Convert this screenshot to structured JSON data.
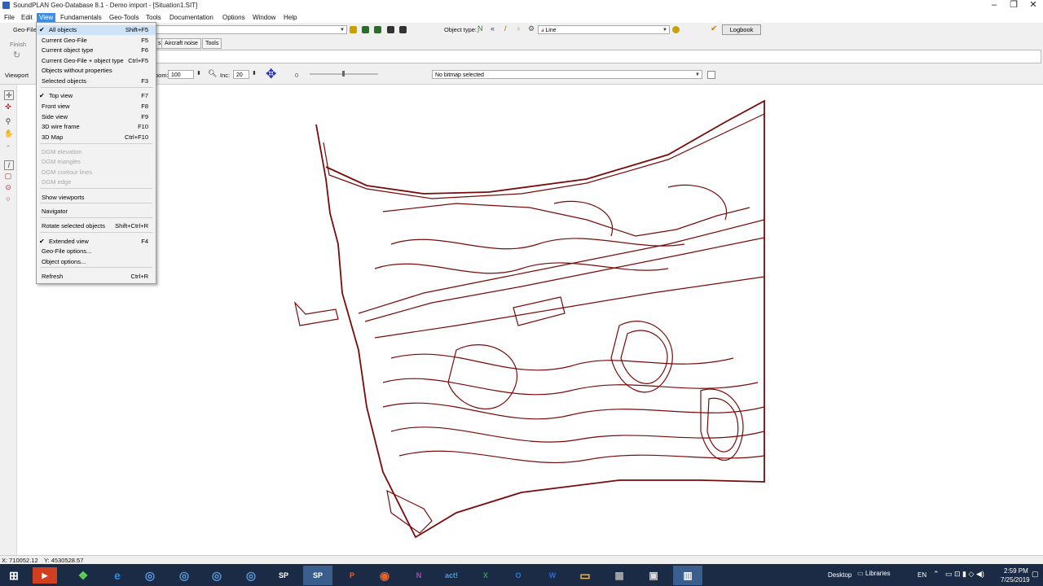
{
  "window": {
    "title": "SoundPLAN Geo-Database 8.1 - Demo import - [Situation1.SIT]"
  },
  "menus": [
    "File",
    "Edit",
    "View",
    "Fundamentals",
    "Geo-Tools",
    "Tools",
    "Documentation",
    "Options",
    "Window",
    "Help"
  ],
  "toolbar": {
    "geofile_label": "Geo-File",
    "object_type_label": "Object type:",
    "object_type_value": "Line",
    "logbook_label": "Logbook",
    "finish_label": "Finish",
    "tabs": [
      "s",
      "Aircraft noise",
      "Tools"
    ]
  },
  "viewport": {
    "label": "Viewport",
    "zoom_label": "oom:",
    "zoom_value": "100",
    "inc_label": "Inc:",
    "inc_value": "20",
    "rotation_value": "0",
    "bitmap_value": "No bitmap selected"
  },
  "view_menu": [
    {
      "label": "All objects",
      "shortcut": "Shift+F5",
      "checked": true,
      "disabled": false
    },
    {
      "label": "Current Geo-File",
      "shortcut": "F5",
      "checked": false,
      "disabled": false
    },
    {
      "label": "Current object type",
      "shortcut": "F6",
      "checked": false,
      "disabled": false
    },
    {
      "label": "Current Geo-File + object type",
      "shortcut": "Ctrl+F5",
      "checked": false,
      "disabled": false
    },
    {
      "label": "Objects without properties",
      "shortcut": "",
      "checked": false,
      "disabled": false
    },
    {
      "label": "Selected objects",
      "shortcut": "F3",
      "checked": false,
      "disabled": false
    },
    {
      "label": "Top view",
      "shortcut": "F7",
      "checked": true,
      "disabled": false
    },
    {
      "label": "Front  view",
      "shortcut": "F8",
      "checked": false,
      "disabled": false
    },
    {
      "label": "Side view",
      "shortcut": "F9",
      "checked": false,
      "disabled": false
    },
    {
      "label": "3D wire frame",
      "shortcut": "F10",
      "checked": false,
      "disabled": false
    },
    {
      "label": "3D Map",
      "shortcut": "Ctrl+F10",
      "checked": false,
      "disabled": false
    },
    {
      "label": "DGM elevation",
      "shortcut": "",
      "checked": false,
      "disabled": true
    },
    {
      "label": "DGM triangles",
      "shortcut": "",
      "checked": false,
      "disabled": true
    },
    {
      "label": "DGM contour lines",
      "shortcut": "",
      "checked": false,
      "disabled": true
    },
    {
      "label": "DGM edge",
      "shortcut": "",
      "checked": false,
      "disabled": true
    },
    {
      "label": "Show viewports",
      "shortcut": "",
      "checked": false,
      "disabled": false
    },
    {
      "label": "Navigator",
      "shortcut": "",
      "checked": false,
      "disabled": false
    },
    {
      "label": "Rotate selected objects",
      "shortcut": "Shift+Ctrl+R",
      "checked": false,
      "disabled": false
    },
    {
      "label": "Extended view",
      "shortcut": "F4",
      "checked": true,
      "disabled": false
    },
    {
      "label": "Geo-File options...",
      "shortcut": "",
      "checked": false,
      "disabled": false
    },
    {
      "label": "Object options...",
      "shortcut": "",
      "checked": false,
      "disabled": false
    },
    {
      "label": "Refresh",
      "shortcut": "Ctrl+R",
      "checked": false,
      "disabled": false
    }
  ],
  "status": {
    "x": "X: 710052.12",
    "y": "Y: 4530528.57"
  },
  "taskbar": {
    "desktop_label": "Desktop",
    "libraries_label": "Libraries",
    "lang": "EN",
    "time": "2:59 PM",
    "date": "7/25/2019",
    "apps": [
      "SP",
      "SP",
      "P",
      "N",
      "act!",
      "X",
      "O",
      "W"
    ]
  },
  "colors": {
    "contour": "#7a0a0a",
    "menu_highlight": "#3d8ee0",
    "taskbar": "#1c2b45"
  }
}
